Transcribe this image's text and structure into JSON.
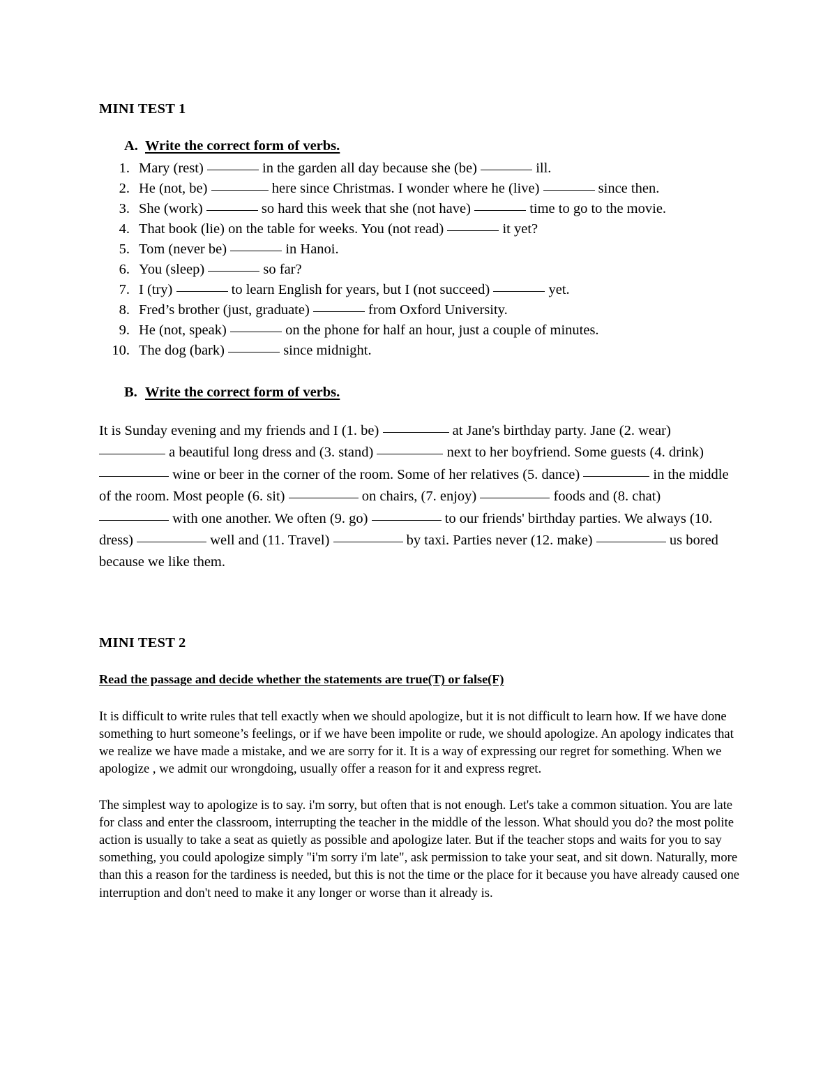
{
  "document": {
    "test1": {
      "heading": "MINI TEST 1",
      "sectionA": {
        "letter": "A.",
        "title": "Write the correct form of verbs.",
        "items": [
          {
            "num": "1.",
            "pre": "Mary (rest)",
            "mid": "in the garden all day because she (be)",
            "post": "ill."
          },
          {
            "num": "2.",
            "pre": "He (not, be)",
            "mid": "here since Christmas. I wonder where he (live)",
            "post": "since then."
          },
          {
            "num": "3.",
            "pre": "She (work)",
            "mid": "so hard this week that she (not have)",
            "post": "time to go to the movie."
          },
          {
            "num": "4.",
            "pre": "That book (lie) on the table for weeks. You (not read)",
            "mid": "",
            "post": "it yet?"
          },
          {
            "num": "5.",
            "pre": "Tom (never be)",
            "mid": "",
            "post": "in Hanoi."
          },
          {
            "num": "6.",
            "pre": "You (sleep)",
            "mid": "",
            "post": "so far?"
          },
          {
            "num": "7.",
            "pre": "I (try)",
            "mid": "to learn English for years, but I (not succeed)",
            "post": "yet."
          },
          {
            "num": "8.",
            "pre": "Fred’s brother (just, graduate)",
            "mid": "",
            "post": "from Oxford University."
          },
          {
            "num": "9.",
            "pre": "He (not, speak)",
            "mid": "",
            "post": "on the phone for half an hour, just a couple of minutes."
          },
          {
            "num": "10.",
            "pre": "The dog (bark)",
            "mid": "",
            "post": "since midnight."
          }
        ]
      },
      "sectionB": {
        "letter": "B.",
        "title": "Write the correct form of verbs.",
        "paragraph_parts": [
          "It is Sunday evening and my friends and I (1. be)",
          "at Jane's birthday party. Jane (2. wear)",
          "a beautiful long dress and (3. stand)",
          "next to her boyfriend. Some guests (4. drink)",
          "wine or beer in the corner of the room. Some of her relatives (5. dance)",
          "in the middle of the room. Most people (6. sit)",
          "on chairs, (7. enjoy)",
          "foods and (8. chat)",
          "with one another. We often (9. go)",
          "to our friends' birthday parties. We always (10. dress)",
          "well and (11. Travel)",
          "by taxi. Parties never (12. make)",
          "us bored because we like them."
        ]
      }
    },
    "test2": {
      "heading": "MINI TEST 2",
      "instruction": "Read the passage and decide whether the statements are true(T) or false(F)",
      "passages": [
        "It is difficult to write rules that tell exactly when we should apologize, but it is not difficult to learn how. If we have done something to hurt someone’s feelings, or if we have been impolite or rude, we should apologize. An apology indicates that we realize we have made a mistake, and we are sorry for it. It is a way of expressing our regret for something. When we apologize , we admit our wrongdoing, usually offer a reason for it and express regret.",
        "The simplest way to apologize is to say. i'm sorry, but often that is not enough. Let's take a common situation. You are late for class and enter the classroom, interrupting the teacher in the middle of the lesson. What should you do? the most polite action is usually to take a seat as quietly as possible and apologize later. But if the teacher stops and waits for you to say something, you could apologize simply \"i'm sorry i'm late\", ask permission to take your seat, and sit down. Naturally, more than this a reason for the tardiness is needed, but this is not the time or the place for it because you have already caused one interruption and don't need to make it any longer or worse than it already is."
      ]
    }
  }
}
